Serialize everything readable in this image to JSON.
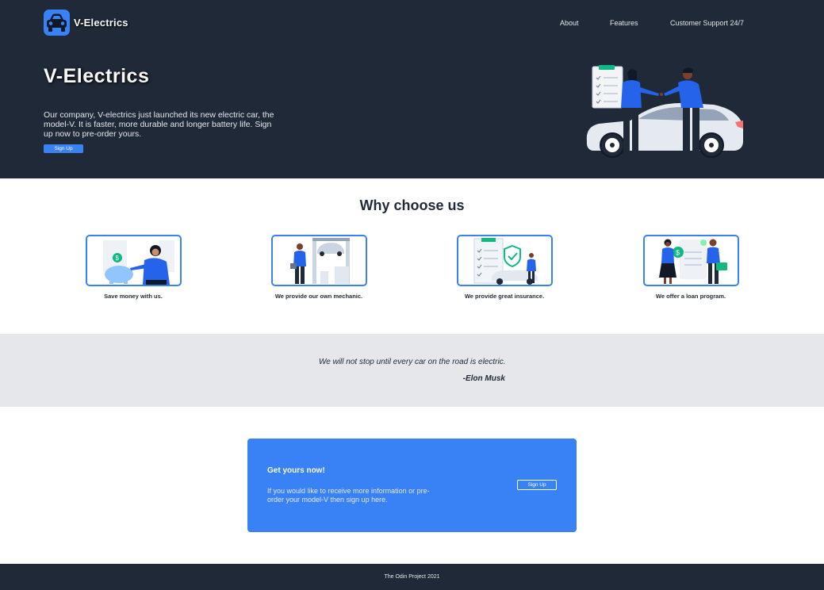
{
  "brand": {
    "name": "V-Electrics",
    "icon": "car-icon",
    "accent": "#3882f6"
  },
  "nav": {
    "items": [
      "About",
      "Features",
      "Customer Support 24/7"
    ]
  },
  "hero": {
    "title": "V-Electrics",
    "description": "Our company, V-electrics just launched its new electric car, the model-V. It is faster, more durable and longer battery life. Sign up now to pre-order yours.",
    "button": "Sign Up",
    "illustration": "car-handover-illustration"
  },
  "info": {
    "title": "Why choose us",
    "cards": [
      {
        "text": "Save money with us.",
        "illustration": "piggy-bank-illustration"
      },
      {
        "text": "We provide our own mechanic.",
        "illustration": "mechanic-lift-illustration"
      },
      {
        "text": "We provide great insurance.",
        "illustration": "insurance-shield-illustration"
      },
      {
        "text": "We offer a loan program.",
        "illustration": "loan-illustration"
      }
    ]
  },
  "quote": {
    "text": "We will not stop until every car on the road is electric.",
    "author": "-Elon Musk"
  },
  "cta": {
    "title": "Get yours now!",
    "description": "If you would like to receive more information or pre-order your model-V then sign up here.",
    "button": "Sign Up"
  },
  "footer": {
    "text": "The Odin Project 2021"
  },
  "colors": {
    "dark": "#1f2937",
    "light_gray": "#e5e7eb",
    "blue": "#3882f6",
    "white": "#f9faf8"
  }
}
